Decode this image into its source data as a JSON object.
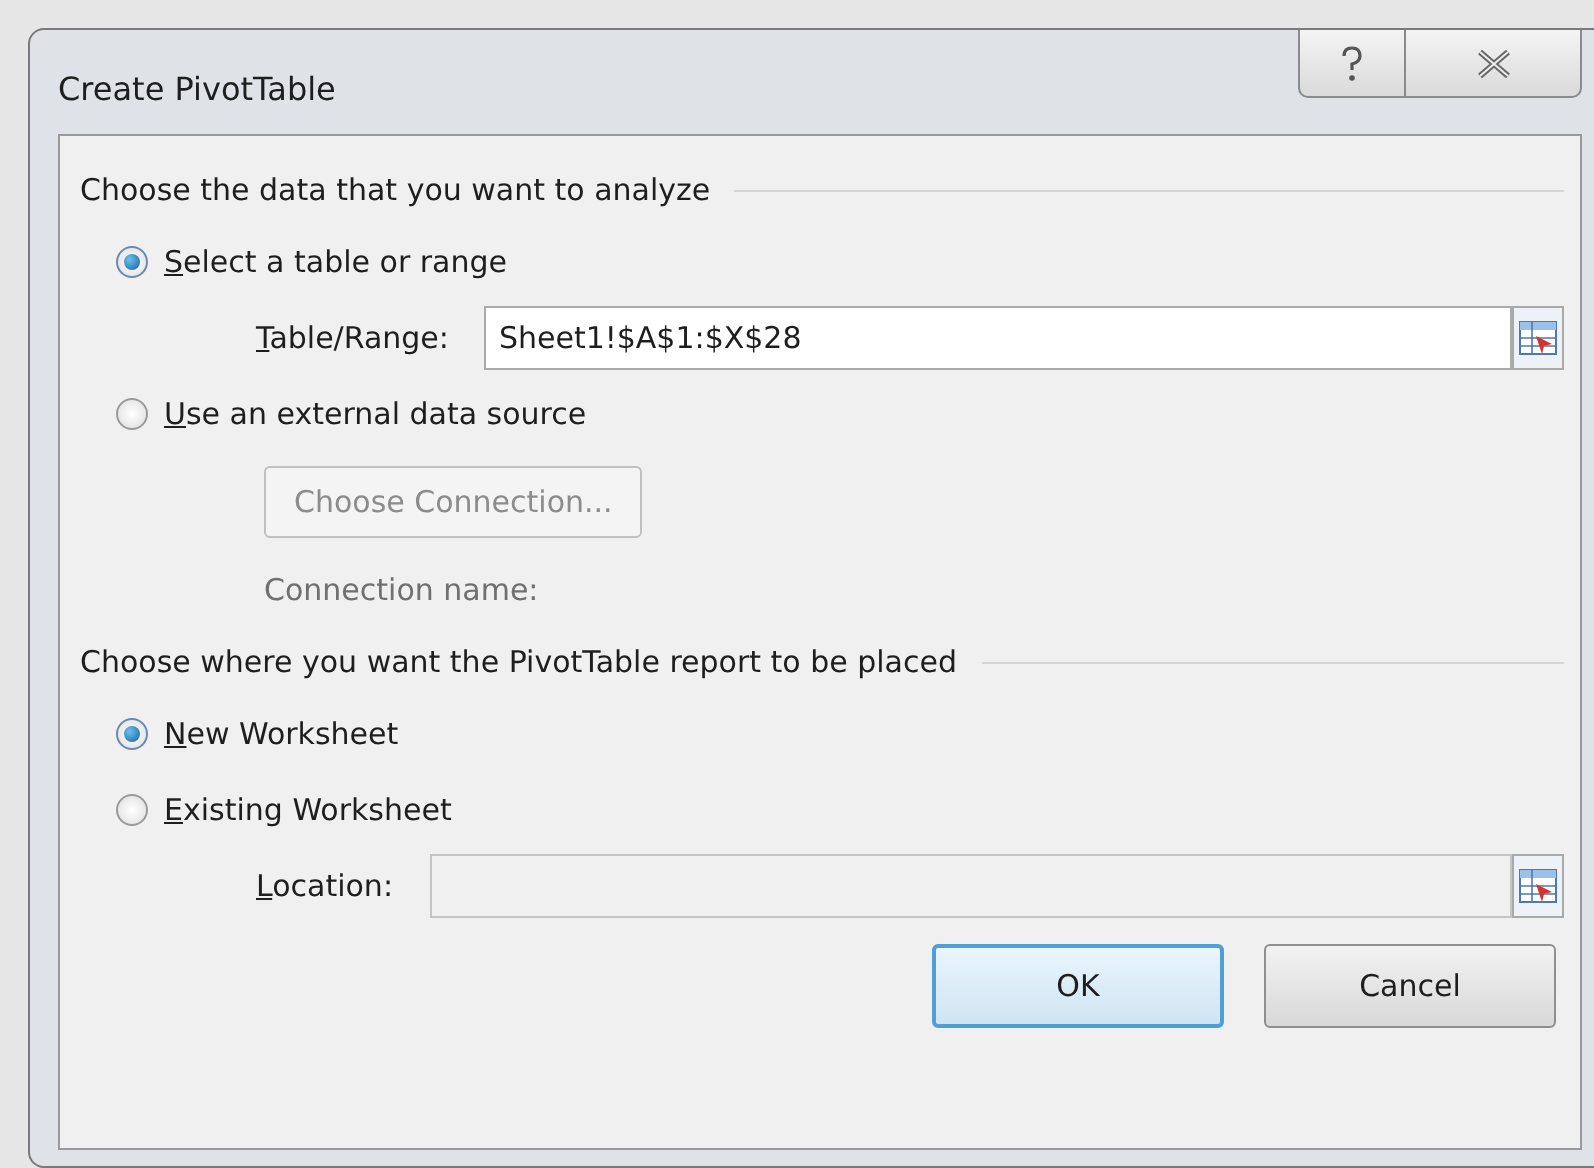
{
  "window": {
    "title": "Create PivotTable"
  },
  "sections": [
    {
      "heading": "Choose the data that you want to analyze",
      "items": [
        {
          "kind": "radio",
          "key": "S",
          "rest": "elect a table or range",
          "selected": true
        },
        {
          "kind": "field",
          "key": "T",
          "rest": "able/Range:",
          "value": "Sheet1!$A$1:$X$28",
          "disabled": false
        },
        {
          "kind": "radio",
          "key": "U",
          "rest": "se an external data source",
          "selected": false
        },
        {
          "kind": "button",
          "label": "Choose Connection...",
          "disabled": true
        },
        {
          "kind": "label",
          "text": "Connection name:",
          "disabled": true
        }
      ]
    },
    {
      "heading": "Choose where you want the PivotTable report to be placed",
      "items": [
        {
          "kind": "radio",
          "key": "N",
          "rest": "ew Worksheet",
          "selected": true
        },
        {
          "kind": "radio",
          "key": "E",
          "rest": "xisting Worksheet",
          "selected": false
        },
        {
          "kind": "field",
          "key": "L",
          "rest": "ocation:",
          "disabled": true
        }
      ]
    }
  ],
  "buttons": [
    {
      "label": "OK",
      "default": true
    },
    {
      "label": "Cancel",
      "default": false
    }
  ]
}
